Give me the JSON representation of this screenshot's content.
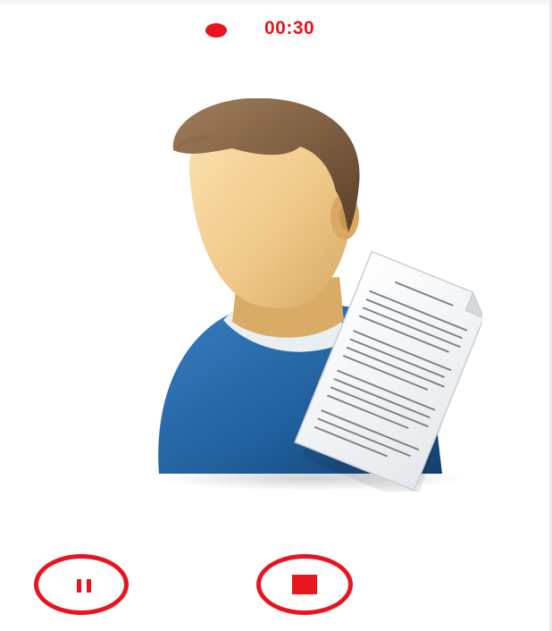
{
  "recording": {
    "indicator_icon": "record-dot-icon",
    "elapsed_time": "00:30"
  },
  "avatar": {
    "icon": "user-with-document-icon"
  },
  "controls": {
    "pause_icon": "pause-icon",
    "stop_icon": "stop-icon"
  },
  "colors": {
    "accent": "#e8141e",
    "shirt": "#1f5f9c",
    "hair": "#7a5a3e",
    "skin": "#f2cf8f"
  }
}
